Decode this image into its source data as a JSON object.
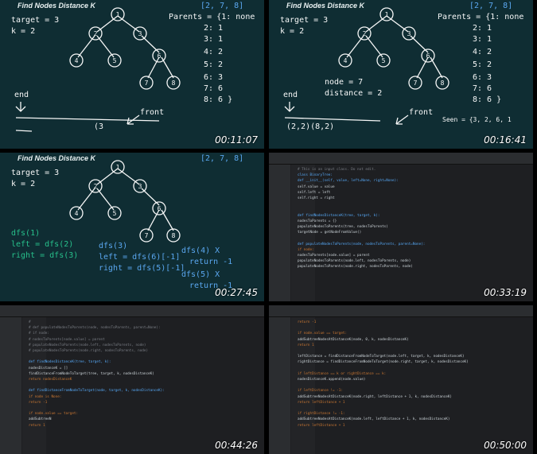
{
  "tiles": [
    {
      "title": "Find Nodes Distance K",
      "timestamp": "00:11:07",
      "notes": {
        "target": "target = 3",
        "k": "k = 2",
        "parents": "Parents = {1: none",
        "p2": "2: 1",
        "p3": "3: 1",
        "p4": "4: 2",
        "p5": "5: 2",
        "p6": "6: 3",
        "p7": "7: 6",
        "p8": "8: 6 }",
        "bracket": "[2, 7, 8]",
        "end": "end",
        "front": "front",
        "queue": "(3"
      }
    },
    {
      "title": "Find Nodes Distance K",
      "timestamp": "00:16:41",
      "notes": {
        "target": "target = 3",
        "k": "k = 2",
        "parents": "Parents = {1: none",
        "p2": "2: 1",
        "p3": "3: 1",
        "p4": "4: 2",
        "p5": "5: 2",
        "p6": "6: 3",
        "p7": "7: 6",
        "p8": "8: 6 }",
        "bracket": "[2, 7, 8]",
        "node": "node = 7",
        "distance": "distance = 2",
        "end": "end",
        "front": "front",
        "queue": "(2,2)(8,2)",
        "seen": "Seen = {3, 2, 6, 1"
      }
    },
    {
      "title": "Find Nodes Distance K",
      "timestamp": "00:27:45",
      "notes": {
        "target": "target = 3",
        "k": "k = 2",
        "bracket": "[2, 7, 8]",
        "dfs1": "dfs(1)",
        "left1": "left = dfs(2)",
        "right1": "right = dfs(3)",
        "dfs3": "dfs(3)",
        "left3": "left = dfs(6)[-1]",
        "right3": "right = dfs(5)[-1]",
        "dfs4": "dfs(4) X",
        "ret4": "return -1",
        "dfs5": "dfs(5) X",
        "ret5": "return -1"
      }
    },
    {
      "timestamp": "00:33:19",
      "code": [
        "# This is an input class. Do not edit.",
        "class BinaryTree:",
        "    def __init__(self, value, left=None, right=None):",
        "        self.value = value",
        "        self.left = left",
        "        self.right = right",
        "",
        "",
        "def findNodesDistanceK(tree, target, k):",
        "    nodesToParents = {}",
        "    populateNodesToParents(tree, nodesToParents)",
        "    targetNode = getNodeFromValue()",
        "",
        "def populateNodesToParents(node, nodesToParents, parent=None):",
        "    if node:",
        "        nodesToParents[node.value] = parent",
        "        populateNodesToParents(node.left, nodesToParents, node)",
        "        populateNodesToParents(node.right, nodesToParents, node)"
      ]
    },
    {
      "timestamp": "00:44:26",
      "code": [
        "#",
        "# def populateNodesToParents(node, nodesToParents, parent=None):",
        "#     if node:",
        "#         nodesToParents[node.value] = parent",
        "#         populateNodesToParents(node.left, nodesToParents, node)",
        "#         populateNodesToParents(node.right, nodesToParents, node)",
        "",
        "def findNodesDistanceK(tree, target, k):",
        "    nodesDistanceK = []",
        "    findDistanceFromNodeToTarget(tree, target, k, nodesDistanceK)",
        "    return nodesDistanceK",
        "",
        "def findDistanceFromNodeToTarget(node, target, k, nodesDistanceK):",
        "    if node is None:",
        "        return -1",
        "",
        "    if node.value == target:",
        "        addSubtreeN",
        "        return 1"
      ]
    },
    {
      "timestamp": "00:50:00",
      "code": [
        "        return -1",
        "",
        "    if node.value == target:",
        "        addSubtreeNodesAtDistanceK(node, 0, k, nodesDistanceK)",
        "        return 1",
        "",
        "    leftDistance = findDistanceFromNodeToTarget(node.left, target, k, nodesDistanceK)",
        "    rightDistance = findDistanceFromNodeToTarget(node.right, target, k, nodesDistanceK)",
        "",
        "    if leftDistance == k or rightDistance == k:",
        "        nodesDistanceK.append(node.value)",
        "",
        "    if leftDistance != -1:",
        "        addSubtreeNodesAtDistanceK(node.right, leftDistance + 1, k, nodesDistanceK)",
        "        return leftDistance + 1",
        "",
        "    if rightDistance != -1:",
        "        addSubtreeNodesAtDistanceK(node.left, leftDistance + 1, k, nodesDistanceK)",
        "        return leftDistance + 1"
      ]
    }
  ],
  "tree_nodes": [
    "1",
    "2",
    "3",
    "4",
    "5",
    "6",
    "7",
    "8"
  ],
  "colors": {
    "board_bg": "#0f2d33",
    "editor_bg": "#1e1f22",
    "chalk": "#f6f7f7",
    "blue_ink": "#5aa7f0",
    "green_ink": "#27c08b"
  }
}
